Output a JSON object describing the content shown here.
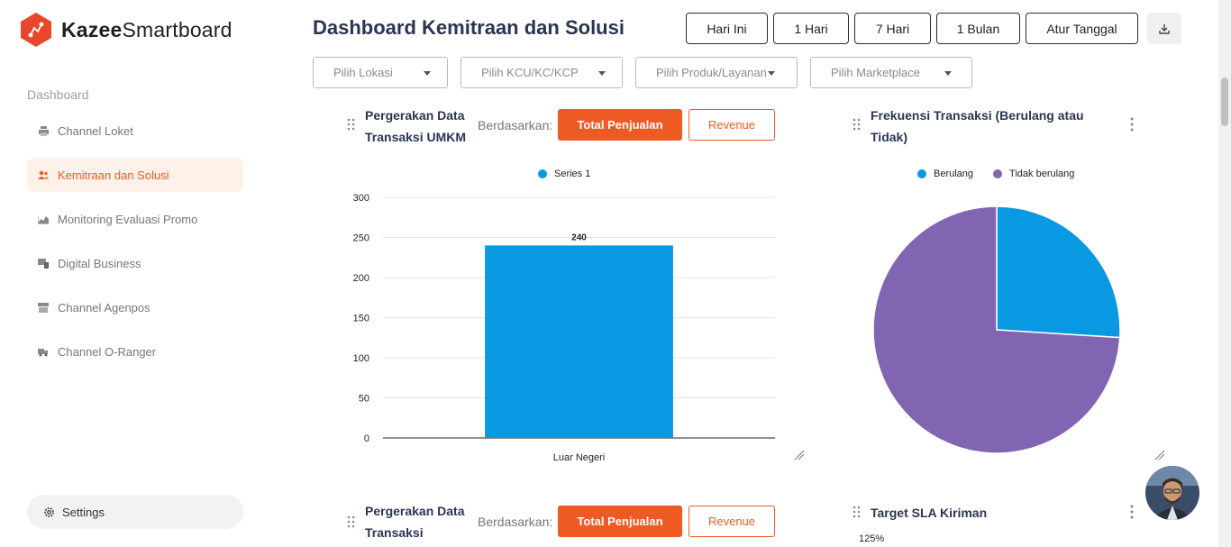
{
  "brand": {
    "name_bold": "Kazee",
    "name_rest": "Smartboard",
    "color": "#e8472b"
  },
  "sidebar": {
    "section": "Dashboard",
    "items": [
      {
        "label": "Channel Loket",
        "icon": "printer-icon",
        "active": false
      },
      {
        "label": "Kemitraan dan Solusi",
        "icon": "users-icon",
        "active": true
      },
      {
        "label": "Monitoring Evaluasi Promo",
        "icon": "chart-area-icon",
        "active": false
      },
      {
        "label": "Digital Business",
        "icon": "devices-icon",
        "active": false
      },
      {
        "label": "Channel Agenpos",
        "icon": "store-icon",
        "active": false
      },
      {
        "label": "Channel O-Ranger",
        "icon": "truck-icon",
        "active": false
      }
    ],
    "settings_label": "Settings"
  },
  "header": {
    "title": "Dashboard Kemitraan dan Solusi",
    "ranges": [
      "Hari Ini",
      "1 Hari",
      "7 Hari",
      "1 Bulan",
      "Atur Tanggal"
    ],
    "download_icon": "download-icon"
  },
  "filters": [
    "Pilih Lokasi",
    "Pilih KCU/KC/KCP",
    "Pilih Produk/Layanan",
    "Pilih Marketplace"
  ],
  "card1": {
    "title_line1": "Pergerakan Data",
    "title_line2": "Transaksi UMKM",
    "based_label": "Berdasarkan:",
    "btn_primary": "Total Penjualan",
    "btn_secondary": "Revenue"
  },
  "card2": {
    "title_line1": "Frekuensi Transaksi (Berulang atau",
    "title_line2": "Tidak)"
  },
  "card3": {
    "title_line1": "Pergerakan Data",
    "title_line2": "Transaksi",
    "based_label": "Berdasarkan:",
    "btn_primary": "Total Penjualan",
    "btn_secondary": "Revenue"
  },
  "card4": {
    "title": "Target SLA Kiriman",
    "first_tick": "125%"
  },
  "colors": {
    "accent": "#ee5a24",
    "bar": "#0899e2",
    "pie_a": "#0899e2",
    "pie_b": "#8165b2"
  },
  "chart_data": [
    {
      "type": "bar",
      "categories": [
        "Luar Negeri"
      ],
      "series": [
        {
          "name": "Series 1",
          "values": [
            240
          ]
        }
      ],
      "ylim": [
        0,
        300
      ],
      "yticks": [
        0,
        50,
        100,
        150,
        200,
        250,
        300
      ],
      "data_labels": [
        "240"
      ],
      "legend": "top-center"
    },
    {
      "type": "pie",
      "labels": [
        "Berulang",
        "Tidak berulang"
      ],
      "values": [
        26,
        74
      ],
      "legend": "top-center"
    }
  ]
}
